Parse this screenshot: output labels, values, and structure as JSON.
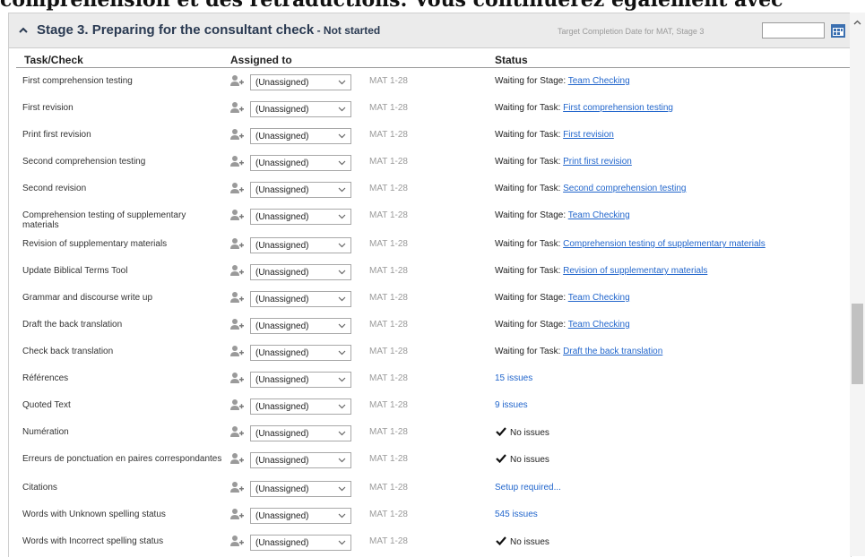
{
  "top_text": "compréhension et des retraductions. Vous continuerez également avec",
  "stage": {
    "title": "Stage 3. Preparing for the consultant check",
    "status": " - Not started",
    "target_label": "Target Completion Date for MAT, Stage 3",
    "target_value": ""
  },
  "columns": {
    "task": "Task/Check",
    "assigned": "Assigned to",
    "status": "Status"
  },
  "rows": [
    {
      "task": "First comprehension testing",
      "assigned": "(Unassigned)",
      "range": "MAT 1-28",
      "status_prefix": "Waiting for Stage: ",
      "status_link": "Team Checking"
    },
    {
      "task": "First revision",
      "assigned": "(Unassigned)",
      "range": "MAT 1-28",
      "status_prefix": "Waiting for Task: ",
      "status_link": "First comprehension testing"
    },
    {
      "task": "Print first revision",
      "assigned": "(Unassigned)",
      "range": "MAT 1-28",
      "status_prefix": "Waiting for Task: ",
      "status_link": "First revision"
    },
    {
      "task": "Second comprehension testing",
      "assigned": "(Unassigned)",
      "range": "MAT 1-28",
      "status_prefix": "Waiting for Task: ",
      "status_link": "Print first revision"
    },
    {
      "task": "Second revision",
      "assigned": "(Unassigned)",
      "range": "MAT 1-28",
      "status_prefix": "Waiting for Task: ",
      "status_link": "Second comprehension testing"
    },
    {
      "task": "Comprehension testing of supplementary materials",
      "assigned": "(Unassigned)",
      "range": "MAT 1-28",
      "status_prefix": "Waiting for Stage: ",
      "status_link": "Team Checking"
    },
    {
      "task": "Revision of supplementary materials",
      "assigned": "(Unassigned)",
      "range": "MAT 1-28",
      "status_prefix": "Waiting for Task: ",
      "status_link": "Comprehension testing of supplementary materials"
    },
    {
      "task": "Update Biblical Terms Tool",
      "assigned": "(Unassigned)",
      "range": "MAT 1-28",
      "status_prefix": "Waiting for Task: ",
      "status_link": "Revision of supplementary materials"
    },
    {
      "task": "Grammar and discourse write up",
      "assigned": "(Unassigned)",
      "range": "MAT 1-28",
      "status_prefix": "Waiting for Stage: ",
      "status_link": "Team Checking"
    },
    {
      "task": "Draft the back translation",
      "assigned": "(Unassigned)",
      "range": "MAT 1-28",
      "status_prefix": "Waiting for Stage: ",
      "status_link": "Team Checking"
    },
    {
      "task": "Check back translation",
      "assigned": "(Unassigned)",
      "range": "MAT 1-28",
      "status_prefix": "Waiting for Task: ",
      "status_link": "Draft the back translation"
    },
    {
      "task": "Références",
      "assigned": "(Unassigned)",
      "range": "MAT 1-28",
      "status_issues": "15 issues"
    },
    {
      "task": "Quoted Text",
      "assigned": "(Unassigned)",
      "range": "MAT 1-28",
      "status_issues": "9 issues"
    },
    {
      "task": "Numération",
      "assigned": "(Unassigned)",
      "range": "MAT 1-28",
      "status_ok": "No issues"
    },
    {
      "task": "Erreurs de ponctuation en paires correspondantes",
      "assigned": "(Unassigned)",
      "range": "MAT 1-28",
      "status_ok": "No issues"
    },
    {
      "task": "Citations",
      "assigned": "(Unassigned)",
      "range": "MAT 1-28",
      "status_issues": "Setup required..."
    },
    {
      "task": "Words with Unknown spelling status",
      "assigned": "(Unassigned)",
      "range": "MAT 1-28",
      "status_issues": "545 issues"
    },
    {
      "task": "Words with Incorrect spelling status",
      "assigned": "(Unassigned)",
      "range": "MAT 1-28",
      "status_ok": "No issues"
    }
  ],
  "icons": {
    "collapse": "chevron-up-icon",
    "calendar": "calendar-icon",
    "user": "add-user-icon",
    "dropdown": "chevron-down-icon",
    "ok": "check-icon"
  },
  "colors": {
    "link": "#2266cc",
    "header_bg": "#ebebeb",
    "title": "#2a3a52",
    "calendar": "#3a6fb0"
  }
}
